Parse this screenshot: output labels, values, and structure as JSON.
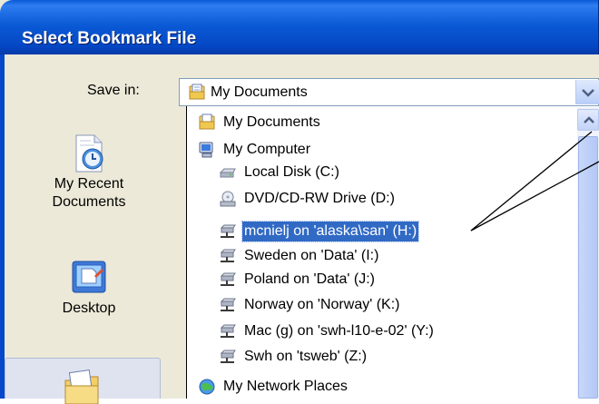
{
  "window": {
    "title": "Select Bookmark File"
  },
  "save_in": {
    "label": "Save in:",
    "value": "My Documents"
  },
  "places_bar": [
    {
      "label_lines": [
        "My Recent",
        "Documents"
      ]
    },
    {
      "label_lines": [
        "Desktop"
      ]
    }
  ],
  "dropdown_items": [
    {
      "label": "My Documents",
      "icon": "my-documents-icon",
      "level": 0
    },
    {
      "label": "My Computer",
      "icon": "my-computer-icon",
      "level": 0
    },
    {
      "label": "Local Disk (C:)",
      "icon": "local-disk-icon",
      "level": 1
    },
    {
      "label": "DVD/CD-RW Drive (D:)",
      "icon": "dvd-drive-icon",
      "level": 1
    },
    {
      "label": "mcnielj on 'alaska\\san' (H:)",
      "icon": "network-drive-icon",
      "level": 1,
      "selected": true
    },
    {
      "label": "Sweden on 'Data' (I:)",
      "icon": "network-drive-icon",
      "level": 1
    },
    {
      "label": "Poland on 'Data' (J:)",
      "icon": "network-drive-icon",
      "level": 1
    },
    {
      "label": "Norway on 'Norway' (K:)",
      "icon": "network-drive-icon",
      "level": 1
    },
    {
      "label": "Mac (g) on 'swh-l10-e-02' (Y:)",
      "icon": "network-drive-icon",
      "level": 1
    },
    {
      "label": "Swh on 'tsweb' (Z:)",
      "icon": "network-drive-icon",
      "level": 1
    },
    {
      "label": "My Network Places",
      "icon": "network-places-icon",
      "level": 0
    }
  ],
  "colors": {
    "titlebar": "#0a5ad8",
    "selection": "#316ac5",
    "dialog_face": "#ece9d8"
  }
}
